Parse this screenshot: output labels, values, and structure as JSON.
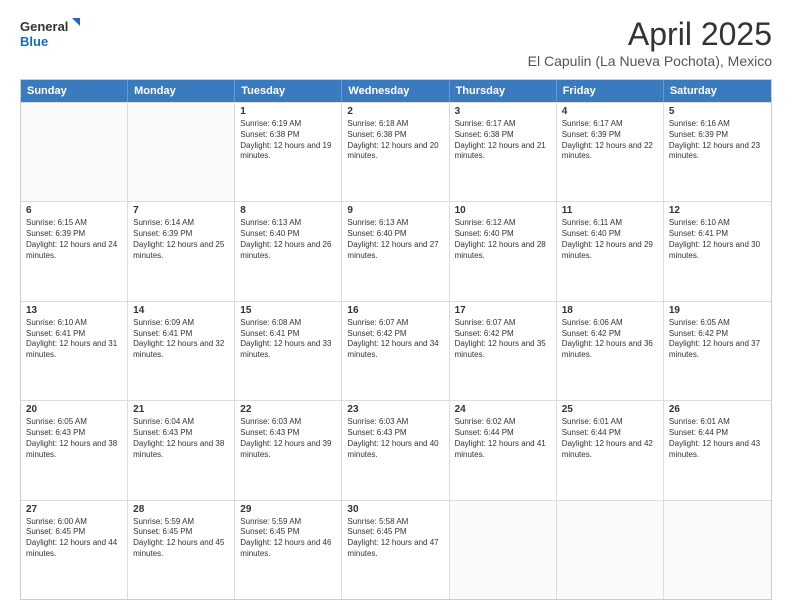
{
  "logo": {
    "line1": "General",
    "line2": "Blue"
  },
  "title": "April 2025",
  "subtitle": "El Capulin (La Nueva Pochota), Mexico",
  "header_days": [
    "Sunday",
    "Monday",
    "Tuesday",
    "Wednesday",
    "Thursday",
    "Friday",
    "Saturday"
  ],
  "weeks": [
    [
      {
        "day": "",
        "sunrise": "",
        "sunset": "",
        "daylight": ""
      },
      {
        "day": "",
        "sunrise": "",
        "sunset": "",
        "daylight": ""
      },
      {
        "day": "1",
        "sunrise": "Sunrise: 6:19 AM",
        "sunset": "Sunset: 6:38 PM",
        "daylight": "Daylight: 12 hours and 19 minutes."
      },
      {
        "day": "2",
        "sunrise": "Sunrise: 6:18 AM",
        "sunset": "Sunset: 6:38 PM",
        "daylight": "Daylight: 12 hours and 20 minutes."
      },
      {
        "day": "3",
        "sunrise": "Sunrise: 6:17 AM",
        "sunset": "Sunset: 6:38 PM",
        "daylight": "Daylight: 12 hours and 21 minutes."
      },
      {
        "day": "4",
        "sunrise": "Sunrise: 6:17 AM",
        "sunset": "Sunset: 6:39 PM",
        "daylight": "Daylight: 12 hours and 22 minutes."
      },
      {
        "day": "5",
        "sunrise": "Sunrise: 6:16 AM",
        "sunset": "Sunset: 6:39 PM",
        "daylight": "Daylight: 12 hours and 23 minutes."
      }
    ],
    [
      {
        "day": "6",
        "sunrise": "Sunrise: 6:15 AM",
        "sunset": "Sunset: 6:39 PM",
        "daylight": "Daylight: 12 hours and 24 minutes."
      },
      {
        "day": "7",
        "sunrise": "Sunrise: 6:14 AM",
        "sunset": "Sunset: 6:39 PM",
        "daylight": "Daylight: 12 hours and 25 minutes."
      },
      {
        "day": "8",
        "sunrise": "Sunrise: 6:13 AM",
        "sunset": "Sunset: 6:40 PM",
        "daylight": "Daylight: 12 hours and 26 minutes."
      },
      {
        "day": "9",
        "sunrise": "Sunrise: 6:13 AM",
        "sunset": "Sunset: 6:40 PM",
        "daylight": "Daylight: 12 hours and 27 minutes."
      },
      {
        "day": "10",
        "sunrise": "Sunrise: 6:12 AM",
        "sunset": "Sunset: 6:40 PM",
        "daylight": "Daylight: 12 hours and 28 minutes."
      },
      {
        "day": "11",
        "sunrise": "Sunrise: 6:11 AM",
        "sunset": "Sunset: 6:40 PM",
        "daylight": "Daylight: 12 hours and 29 minutes."
      },
      {
        "day": "12",
        "sunrise": "Sunrise: 6:10 AM",
        "sunset": "Sunset: 6:41 PM",
        "daylight": "Daylight: 12 hours and 30 minutes."
      }
    ],
    [
      {
        "day": "13",
        "sunrise": "Sunrise: 6:10 AM",
        "sunset": "Sunset: 6:41 PM",
        "daylight": "Daylight: 12 hours and 31 minutes."
      },
      {
        "day": "14",
        "sunrise": "Sunrise: 6:09 AM",
        "sunset": "Sunset: 6:41 PM",
        "daylight": "Daylight: 12 hours and 32 minutes."
      },
      {
        "day": "15",
        "sunrise": "Sunrise: 6:08 AM",
        "sunset": "Sunset: 6:41 PM",
        "daylight": "Daylight: 12 hours and 33 minutes."
      },
      {
        "day": "16",
        "sunrise": "Sunrise: 6:07 AM",
        "sunset": "Sunset: 6:42 PM",
        "daylight": "Daylight: 12 hours and 34 minutes."
      },
      {
        "day": "17",
        "sunrise": "Sunrise: 6:07 AM",
        "sunset": "Sunset: 6:42 PM",
        "daylight": "Daylight: 12 hours and 35 minutes."
      },
      {
        "day": "18",
        "sunrise": "Sunrise: 6:06 AM",
        "sunset": "Sunset: 6:42 PM",
        "daylight": "Daylight: 12 hours and 36 minutes."
      },
      {
        "day": "19",
        "sunrise": "Sunrise: 6:05 AM",
        "sunset": "Sunset: 6:42 PM",
        "daylight": "Daylight: 12 hours and 37 minutes."
      }
    ],
    [
      {
        "day": "20",
        "sunrise": "Sunrise: 6:05 AM",
        "sunset": "Sunset: 6:43 PM",
        "daylight": "Daylight: 12 hours and 38 minutes."
      },
      {
        "day": "21",
        "sunrise": "Sunrise: 6:04 AM",
        "sunset": "Sunset: 6:43 PM",
        "daylight": "Daylight: 12 hours and 38 minutes."
      },
      {
        "day": "22",
        "sunrise": "Sunrise: 6:03 AM",
        "sunset": "Sunset: 6:43 PM",
        "daylight": "Daylight: 12 hours and 39 minutes."
      },
      {
        "day": "23",
        "sunrise": "Sunrise: 6:03 AM",
        "sunset": "Sunset: 6:43 PM",
        "daylight": "Daylight: 12 hours and 40 minutes."
      },
      {
        "day": "24",
        "sunrise": "Sunrise: 6:02 AM",
        "sunset": "Sunset: 6:44 PM",
        "daylight": "Daylight: 12 hours and 41 minutes."
      },
      {
        "day": "25",
        "sunrise": "Sunrise: 6:01 AM",
        "sunset": "Sunset: 6:44 PM",
        "daylight": "Daylight: 12 hours and 42 minutes."
      },
      {
        "day": "26",
        "sunrise": "Sunrise: 6:01 AM",
        "sunset": "Sunset: 6:44 PM",
        "daylight": "Daylight: 12 hours and 43 minutes."
      }
    ],
    [
      {
        "day": "27",
        "sunrise": "Sunrise: 6:00 AM",
        "sunset": "Sunset: 6:45 PM",
        "daylight": "Daylight: 12 hours and 44 minutes."
      },
      {
        "day": "28",
        "sunrise": "Sunrise: 5:59 AM",
        "sunset": "Sunset: 6:45 PM",
        "daylight": "Daylight: 12 hours and 45 minutes."
      },
      {
        "day": "29",
        "sunrise": "Sunrise: 5:59 AM",
        "sunset": "Sunset: 6:45 PM",
        "daylight": "Daylight: 12 hours and 46 minutes."
      },
      {
        "day": "30",
        "sunrise": "Sunrise: 5:58 AM",
        "sunset": "Sunset: 6:45 PM",
        "daylight": "Daylight: 12 hours and 47 minutes."
      },
      {
        "day": "",
        "sunrise": "",
        "sunset": "",
        "daylight": ""
      },
      {
        "day": "",
        "sunrise": "",
        "sunset": "",
        "daylight": ""
      },
      {
        "day": "",
        "sunrise": "",
        "sunset": "",
        "daylight": ""
      }
    ]
  ]
}
